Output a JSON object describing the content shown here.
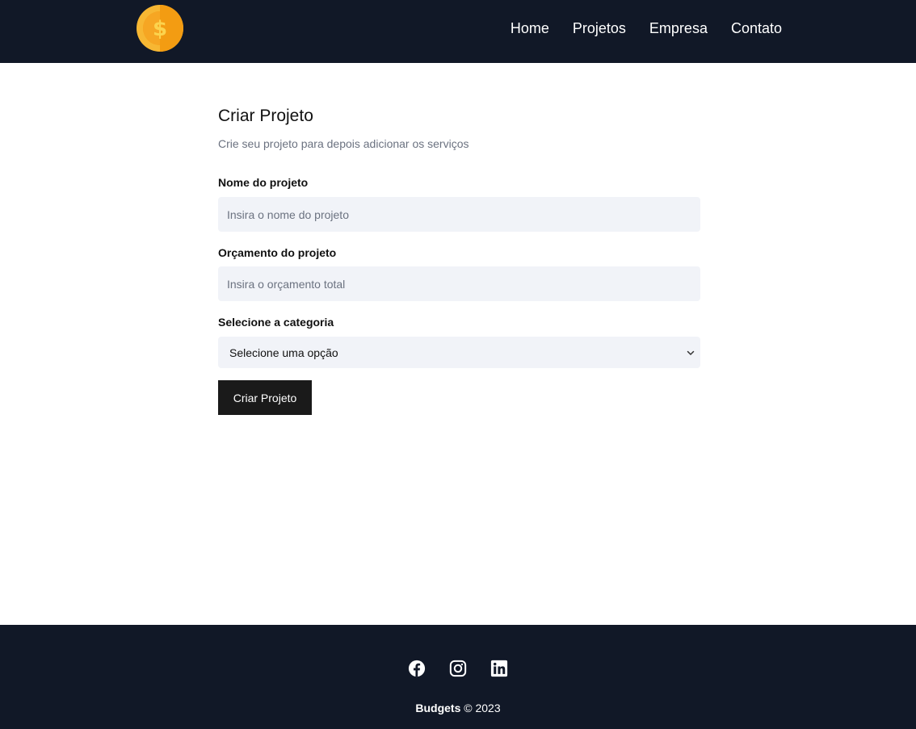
{
  "colors": {
    "navbar_bg": "#111827",
    "footer_bg": "#111827",
    "input_bg": "#f1f3f8",
    "button_bg": "#1a1a1a",
    "coin_gold": "#f7b733",
    "coin_orange": "#f39c12"
  },
  "navbar": {
    "logo_icon": "dollar-coin-icon",
    "links": [
      {
        "label": "Home"
      },
      {
        "label": "Projetos"
      },
      {
        "label": "Empresa"
      },
      {
        "label": "Contato"
      }
    ]
  },
  "form": {
    "title": "Criar Projeto",
    "subtitle": "Crie seu projeto para depois adicionar os serviços",
    "name_label": "Nome do projeto",
    "name_placeholder": "Insira o nome do projeto",
    "name_value": "",
    "budget_label": "Orçamento do projeto",
    "budget_placeholder": "Insira o orçamento total",
    "budget_value": "",
    "category_label": "Selecione a categoria",
    "category_selected": "Selecione uma opção",
    "submit_label": "Criar Projeto"
  },
  "footer": {
    "social_icons": [
      "facebook-icon",
      "instagram-icon",
      "linkedin-icon"
    ],
    "brand": "Budgets",
    "copyright": "© 2023"
  }
}
